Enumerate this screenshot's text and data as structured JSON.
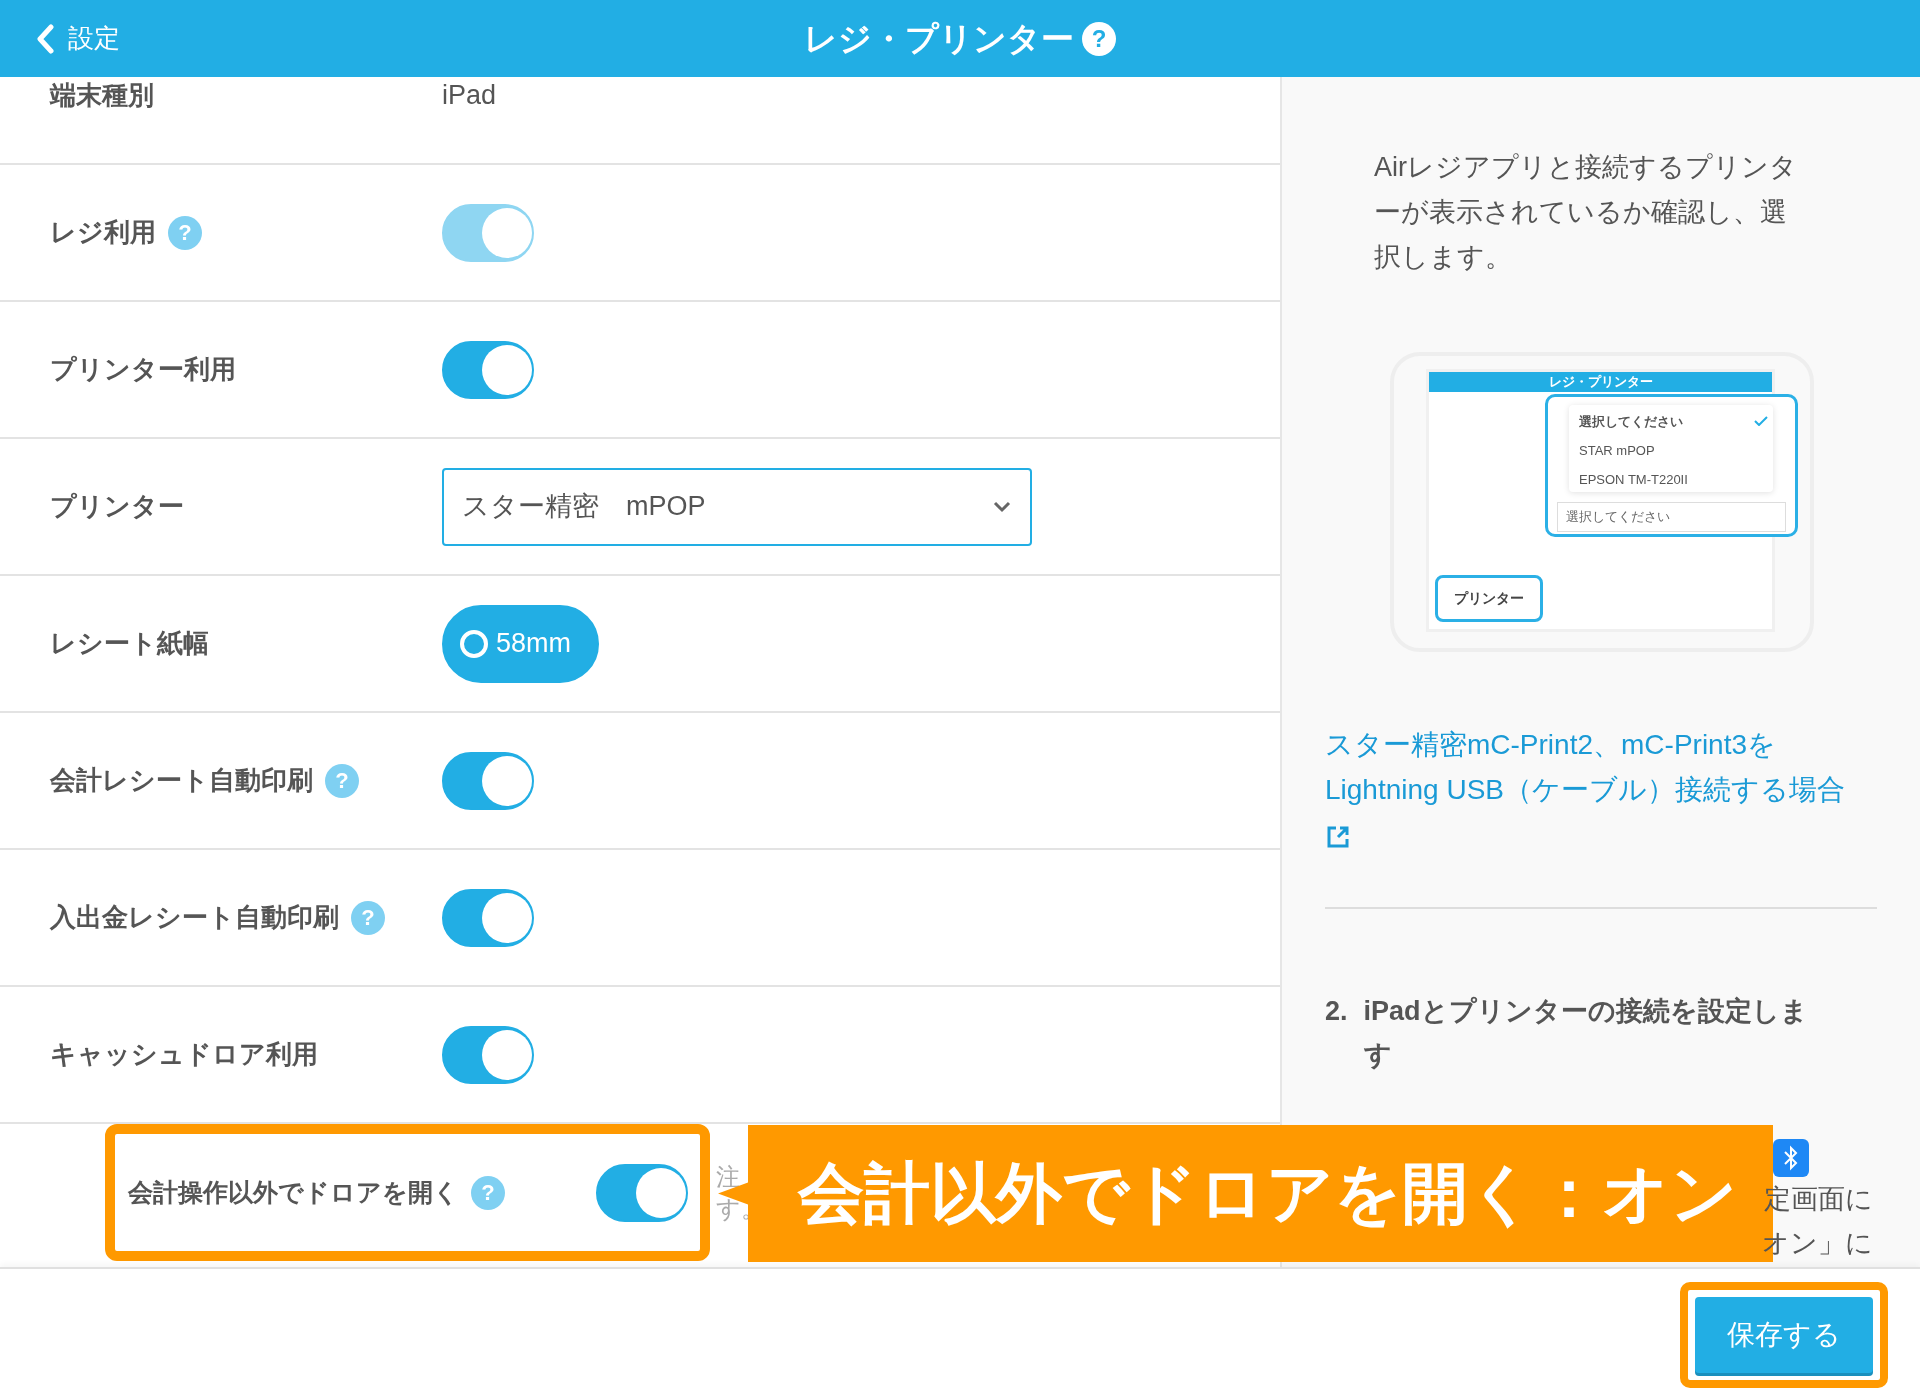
{
  "header": {
    "back_label": "設定",
    "title": "レジ・プリンター",
    "help": "?"
  },
  "rows": [
    {
      "kind": "text",
      "label": "端末種別",
      "value": "iPad"
    },
    {
      "kind": "toggle",
      "label": "レジ利用",
      "help": "?",
      "on": true,
      "disabled": true
    },
    {
      "kind": "toggle",
      "label": "プリンター利用",
      "on": true,
      "disabled": false
    },
    {
      "kind": "select",
      "label": "プリンター",
      "value": "スター精密　mPOP"
    },
    {
      "kind": "radio",
      "label": "レシート紙幅",
      "options": [
        {
          "label": "58mm",
          "selected": true
        }
      ]
    },
    {
      "kind": "toggle",
      "label": "会計レシート自動印刷",
      "help": "?",
      "on": true,
      "disabled": false
    },
    {
      "kind": "toggle",
      "label": "入出金レシート自動印刷",
      "help": "?",
      "on": true,
      "disabled": false
    },
    {
      "kind": "toggle",
      "label": "キャッシュドロア利用",
      "on": true,
      "disabled": false
    },
    {
      "kind": "toggle",
      "label": "会計操作以外でドロアを開く",
      "help": "?",
      "on": true,
      "disabled": false,
      "highlighted": true,
      "note": [
        "注",
        "す。"
      ]
    }
  ],
  "guide": {
    "paragraph": "Airレジアプリと接続するプリンターが表示されているか確認し、選択します。",
    "illustration": {
      "title": "レジ・プリンター",
      "options": [
        {
          "label": "選択してください",
          "selected": true
        },
        {
          "label": "STAR mPOP",
          "selected": false
        },
        {
          "label": "EPSON TM-T220II",
          "selected": false
        }
      ],
      "select_placeholder": "選択してください",
      "callout": "プリンター"
    },
    "link": "スター精密mC-Print2、mC-Print3をLightning USB（ケーブル）接続する場合",
    "step": {
      "number": "2.",
      "title": "iPadとプリンターの接続を設定します"
    },
    "fragments": [
      "定画面に",
      "オン」に"
    ]
  },
  "callout": {
    "text": "会計以外でドロアを開く：オン"
  },
  "footer": {
    "save": "保存する",
    "highlighted": true
  }
}
